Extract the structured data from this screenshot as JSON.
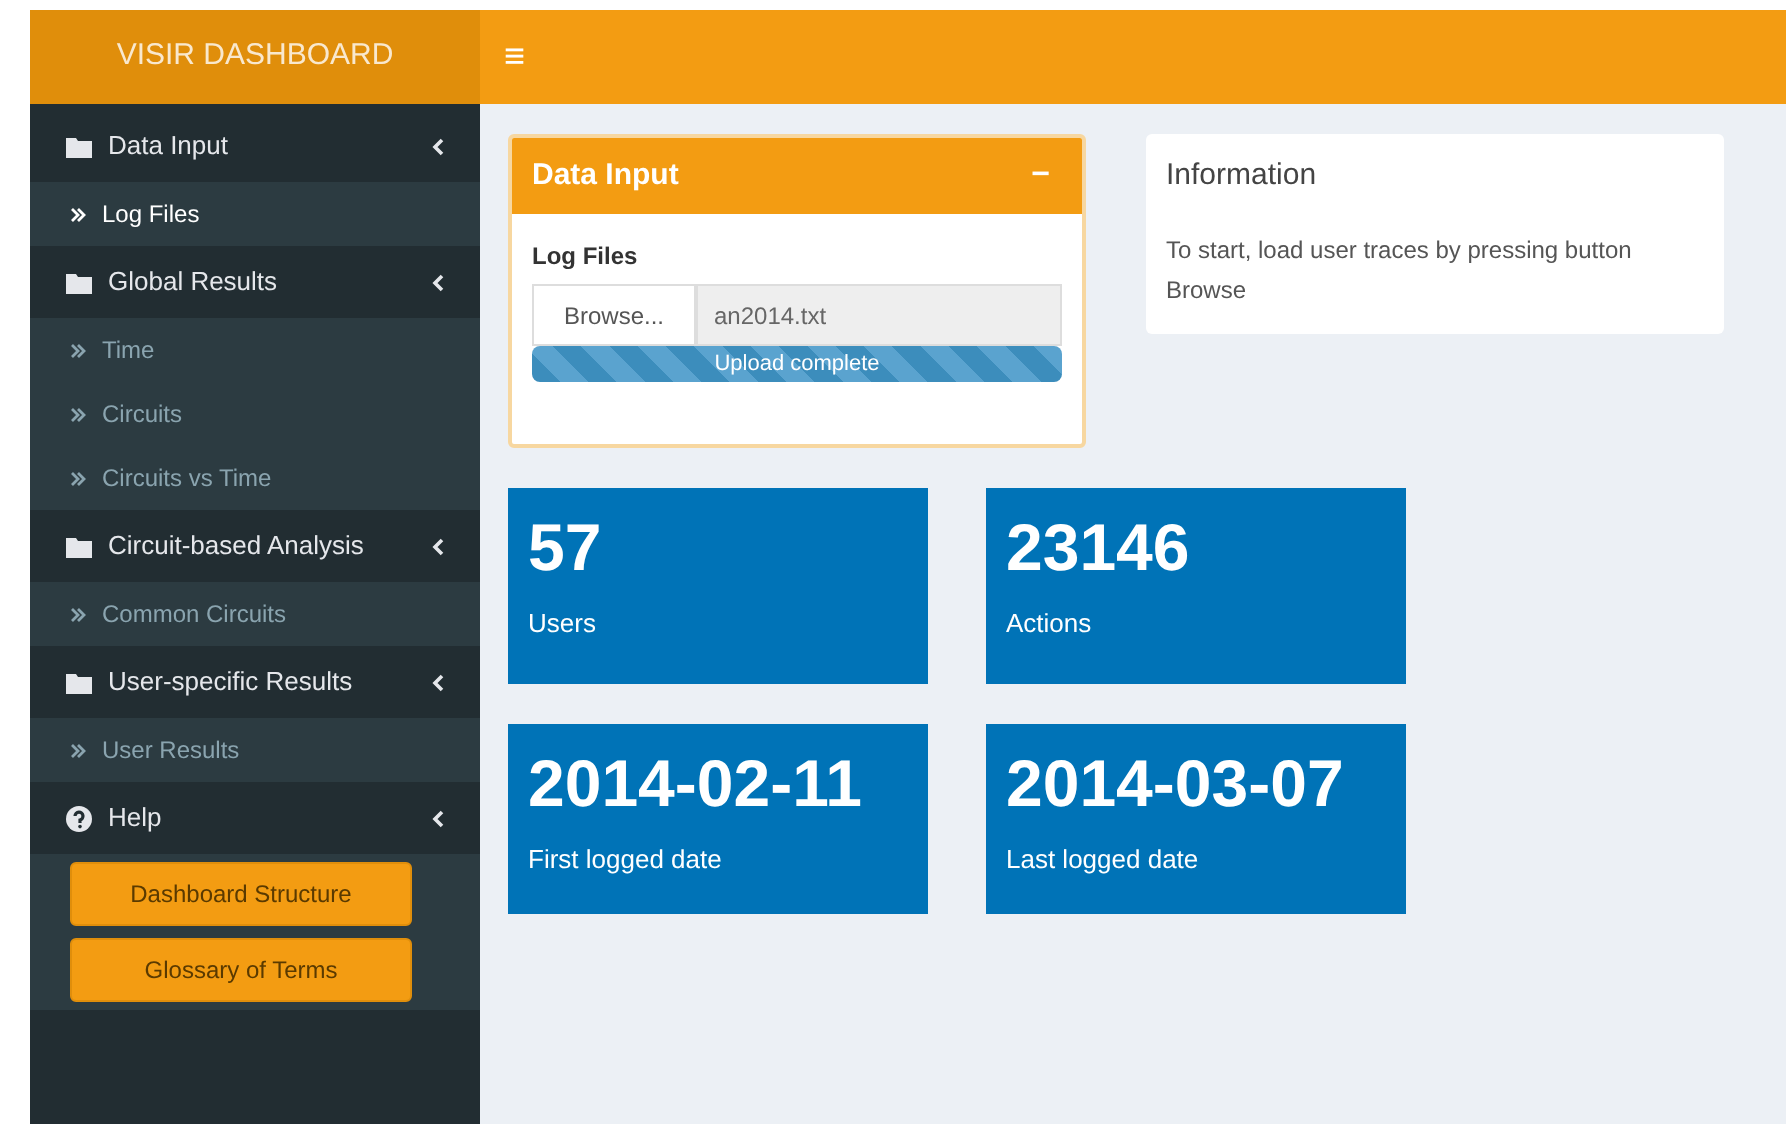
{
  "header": {
    "brand": "VISIR DASHBOARD",
    "menu_toggle": "≡"
  },
  "sidebar": {
    "groups": [
      {
        "label": "Data Input",
        "kind": "folder",
        "expanded": true,
        "children": [
          {
            "label": "Log Files",
            "selected": true
          }
        ]
      },
      {
        "label": "Global Results",
        "kind": "folder",
        "expanded": true,
        "children": [
          {
            "label": "Time",
            "selected": false
          },
          {
            "label": "Circuits",
            "selected": false
          },
          {
            "label": "Circuits vs Time",
            "selected": false
          }
        ]
      },
      {
        "label": "Circuit-based Analysis",
        "kind": "folder",
        "expanded": true,
        "children": [
          {
            "label": "Common Circuits",
            "selected": false
          }
        ]
      },
      {
        "label": "User-specific Results",
        "kind": "folder",
        "expanded": true,
        "children": [
          {
            "label": "User Results",
            "selected": false
          }
        ]
      },
      {
        "label": "Help",
        "kind": "help",
        "expanded": true,
        "buttons": [
          "Dashboard Structure",
          "Glossary of Terms"
        ]
      }
    ]
  },
  "data_input_box": {
    "title": "Data Input",
    "collapse": "−",
    "field_label": "Log Files",
    "browse_button": "Browse...",
    "file_name": "an2014.txt",
    "progress": {
      "level": 1,
      "text": "Upload complete"
    }
  },
  "information_box": {
    "title": "Information",
    "text": "To start, load user traces by pressing button Browse"
  },
  "stats": [
    {
      "value": "57",
      "label": "Users"
    },
    {
      "value": "23146",
      "label": "Actions"
    },
    {
      "value": "2014-02-11",
      "label": "First logged date"
    },
    {
      "value": "2014-03-07",
      "label": "Last logged date"
    }
  ]
}
